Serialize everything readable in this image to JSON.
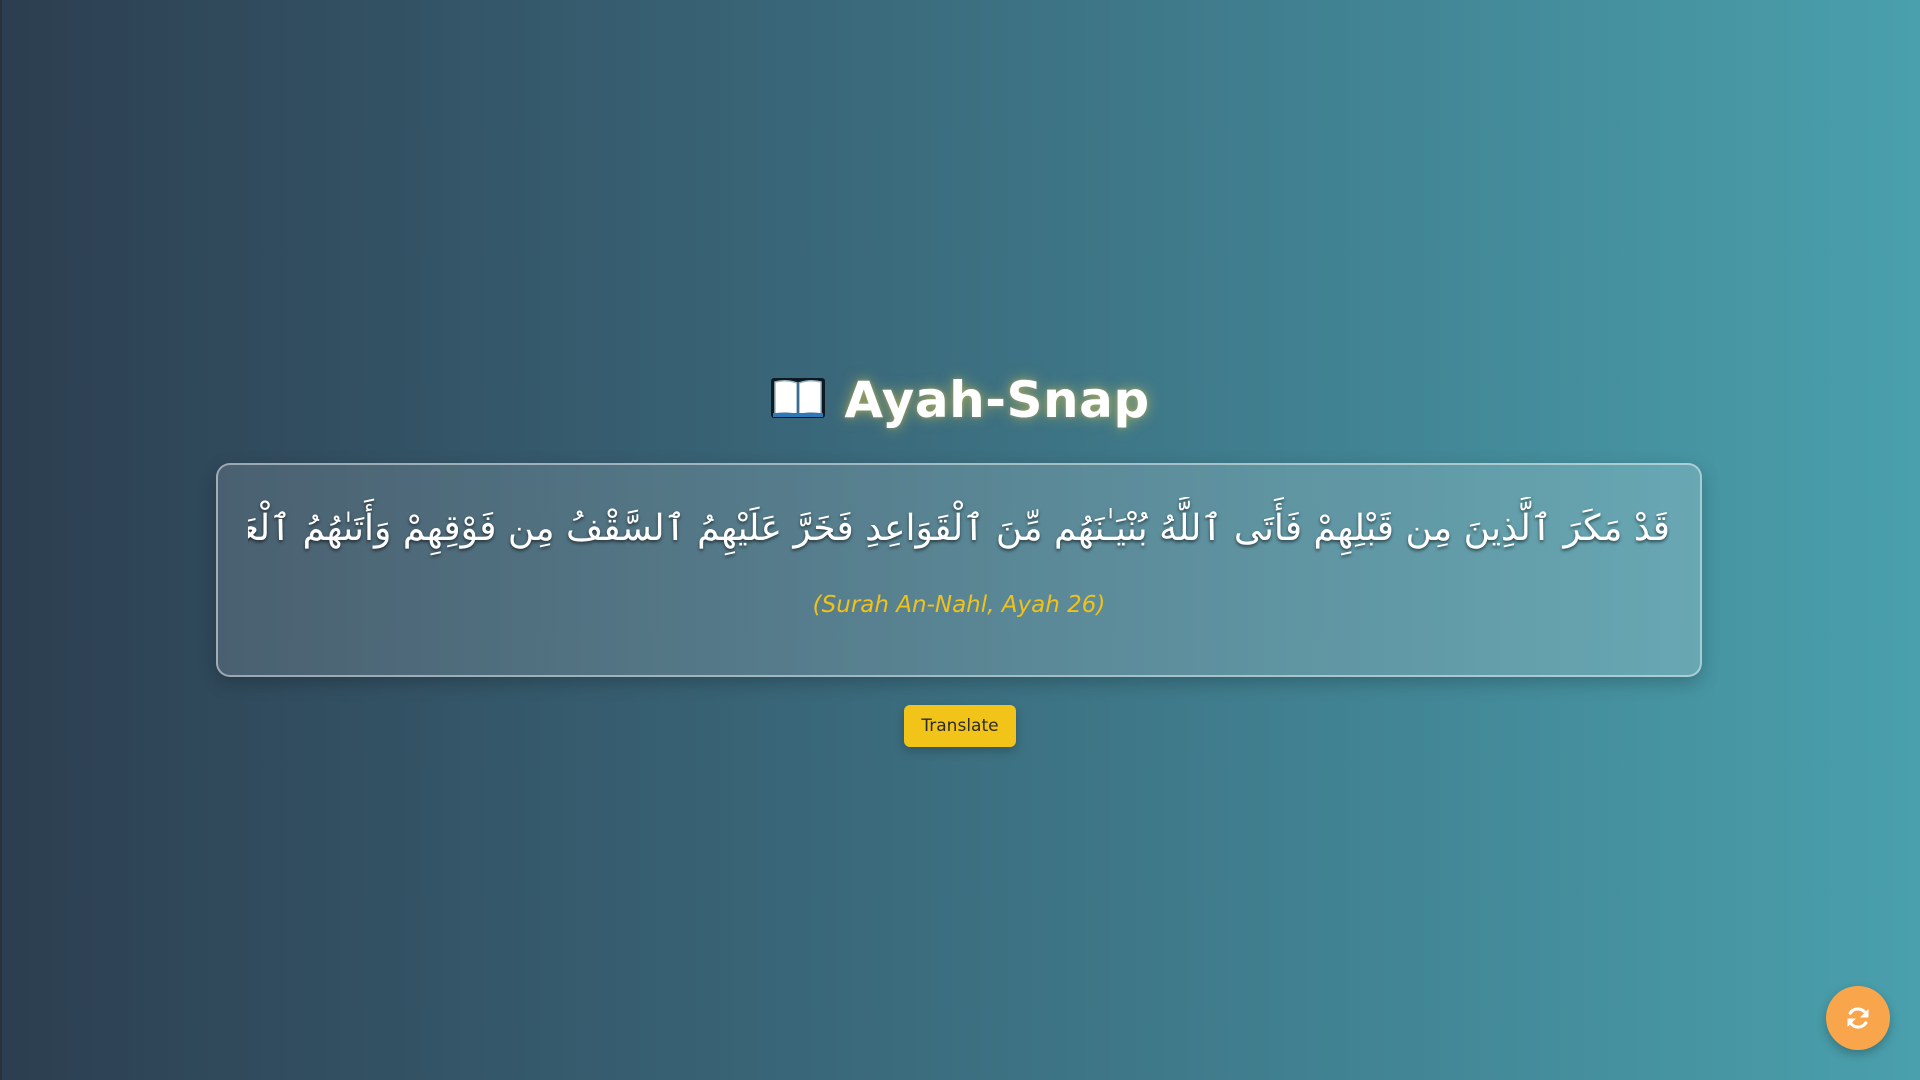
{
  "app": {
    "title": "Ayah-Snap",
    "title_icon": "open-book-icon"
  },
  "ayah": {
    "text": "قَدْ مَكَرَ ٱلَّذِينَ مِن قَبْلِهِمْ فَأَتَى ٱللَّهُ بُنْيَـٰنَهُم مِّنَ ٱلْقَوَاعِدِ فَخَرَّ عَلَيْهِمُ ٱلسَّقْفُ مِن فَوْقِهِمْ وَأَتَىٰهُمُ ٱلْعَذَابُ مِنْ حَيْثُ لَا يَشْعُرُونَ",
    "reference": "(Surah An-Nahl, Ayah 26)"
  },
  "actions": {
    "translate_label": "Translate",
    "refresh_icon": "refresh-icon"
  },
  "colors": {
    "background_start": "#2c3e50",
    "background_end": "#4aa0ad",
    "accent_yellow": "#f2c318",
    "reference_text": "#f0c21a",
    "refresh_button": "#f9a54b"
  }
}
